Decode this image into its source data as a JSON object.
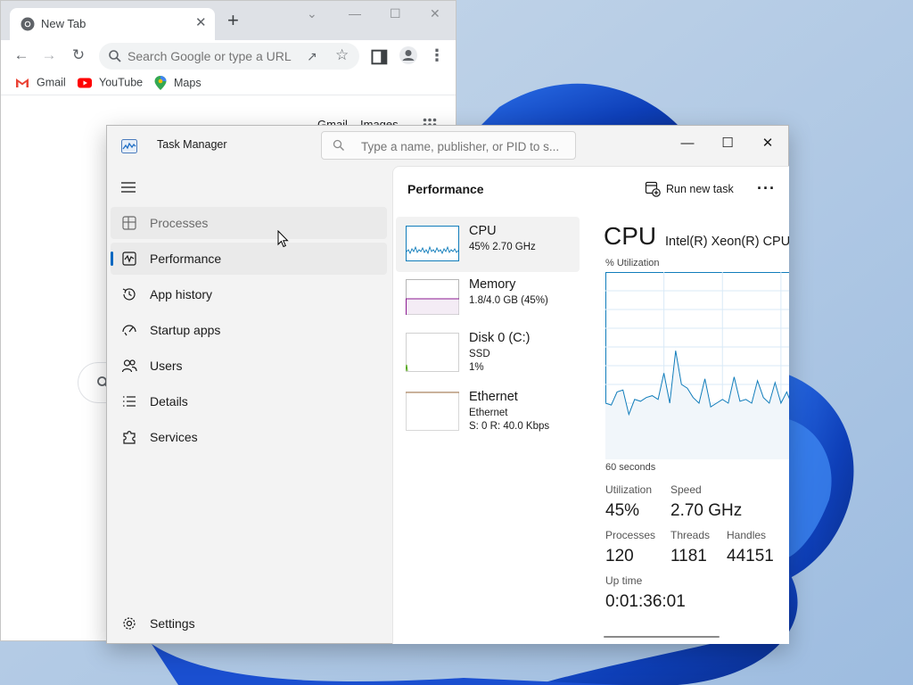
{
  "chrome": {
    "tab_title": "New Tab",
    "tab_close": "✕",
    "new_tab": "+",
    "window_controls": [
      "⌄",
      "—",
      "☐",
      "✕"
    ],
    "omnibox_placeholder": "Search Google or type a URL",
    "bookmarks": [
      "Gmail",
      "YouTube",
      "Maps"
    ],
    "top_links": [
      "Gmail",
      "Images"
    ]
  },
  "task_manager": {
    "title": "Task Manager",
    "search_placeholder": "Type a name, publisher, or PID to s...",
    "window_controls": [
      "—",
      "☐",
      "✕"
    ],
    "nav": [
      {
        "label": "Processes"
      },
      {
        "label": "Performance"
      },
      {
        "label": "App history"
      },
      {
        "label": "Startup apps"
      },
      {
        "label": "Users"
      },
      {
        "label": "Details"
      },
      {
        "label": "Services"
      }
    ],
    "settings_label": "Settings",
    "content_title": "Performance",
    "run_new_task": "Run new task",
    "more": "···",
    "devices": [
      {
        "name": "CPU",
        "sub1": "45% 2.70 GHz"
      },
      {
        "name": "Memory",
        "sub1": "1.8/4.0 GB (45%)"
      },
      {
        "name": "Disk 0 (C:)",
        "sub1": "SSD",
        "sub2": "1%"
      },
      {
        "name": "Ethernet",
        "sub1": "Ethernet",
        "sub2": "S: 0 R: 40.0 Kbps"
      }
    ],
    "cpu_detail": {
      "title": "CPU",
      "model": "Intel(R) Xeon(R) CPU",
      "utilization_label": "% Utilization",
      "seconds_label": "60 seconds",
      "stats": {
        "utilization": {
          "label": "Utilization",
          "value": "45%"
        },
        "speed": {
          "label": "Speed",
          "value": "2.70 GHz"
        },
        "processes": {
          "label": "Processes",
          "value": "120"
        },
        "threads": {
          "label": "Threads",
          "value": "1181"
        },
        "handles": {
          "label": "Handles",
          "value": "44151"
        },
        "uptime": {
          "label": "Up time",
          "value": "0:01:36:01"
        }
      },
      "utilization_history": [
        30,
        29,
        36,
        37,
        24,
        32,
        31,
        33,
        34,
        32,
        46,
        30,
        58,
        40,
        38,
        33,
        30,
        43,
        28,
        30,
        32,
        30,
        44,
        31,
        32,
        30,
        42,
        33,
        30,
        41,
        30,
        36,
        28
      ]
    },
    "accent_color": "#0067c0",
    "graph_color": "#117dbb"
  }
}
